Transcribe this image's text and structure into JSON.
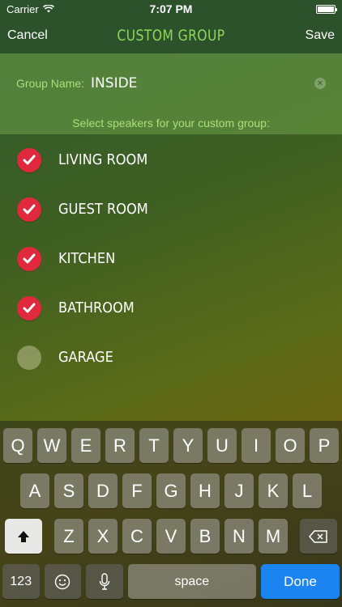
{
  "status": {
    "carrier": "Carrier",
    "time": "7:07 PM"
  },
  "nav": {
    "cancel": "Cancel",
    "title": "CUSTOM GROUP",
    "save": "Save"
  },
  "group": {
    "label": "Group Name:",
    "value": "INSIDE",
    "prompt": "Select speakers for your custom group:"
  },
  "speakers": [
    {
      "name": "LIVING ROOM",
      "selected": true
    },
    {
      "name": "GUEST ROOM",
      "selected": true
    },
    {
      "name": "KITCHEN",
      "selected": true
    },
    {
      "name": "BATHROOM",
      "selected": true
    },
    {
      "name": "GARAGE",
      "selected": false
    }
  ],
  "keyboard": {
    "row1": [
      "Q",
      "W",
      "E",
      "R",
      "T",
      "Y",
      "U",
      "I",
      "O",
      "P"
    ],
    "row2": [
      "A",
      "S",
      "D",
      "F",
      "G",
      "H",
      "J",
      "K",
      "L"
    ],
    "row3": [
      "Z",
      "X",
      "C",
      "V",
      "B",
      "N",
      "M"
    ],
    "numbers": "123",
    "space": "space",
    "done": "Done"
  },
  "colors": {
    "accent_green": "#8fd65a",
    "check_red": "#e0293c",
    "done_blue": "#1b84f0"
  }
}
